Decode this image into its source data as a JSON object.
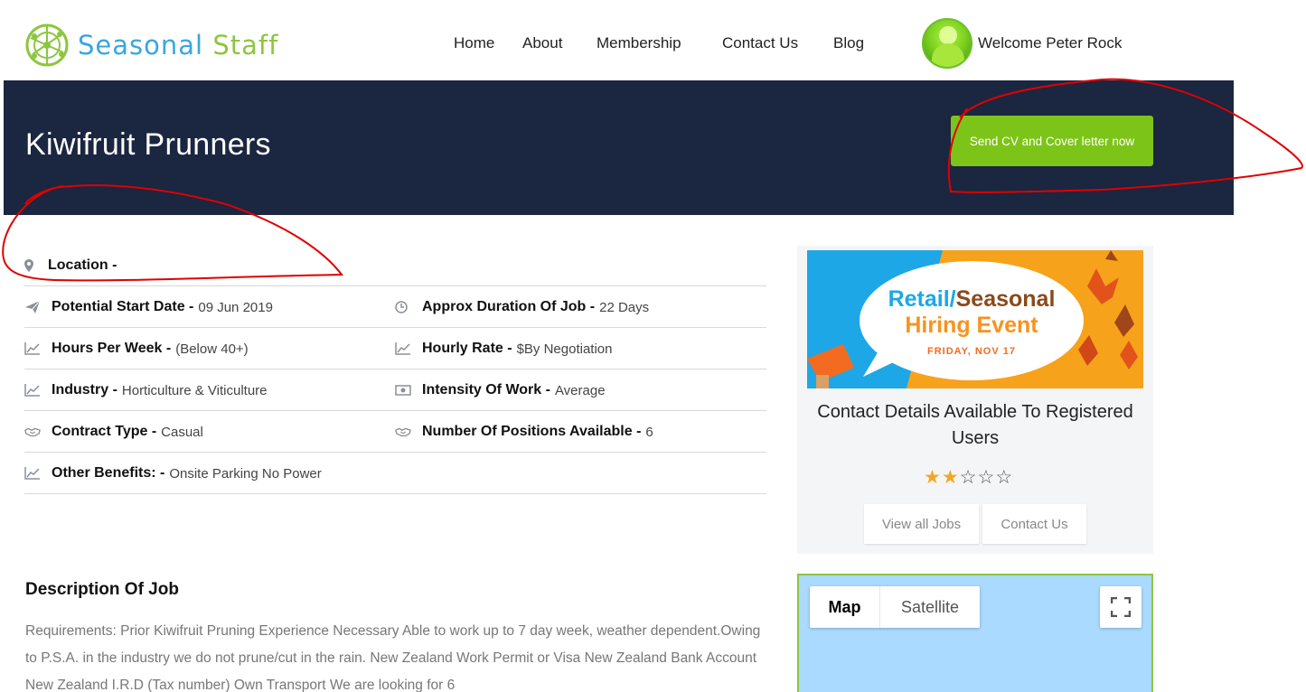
{
  "brand": {
    "name_part1": "Seasonal",
    "name_part2": "Staff"
  },
  "nav": {
    "home": "Home",
    "about": "About",
    "membership": "Membership",
    "contact": "Contact Us",
    "blog": "Blog"
  },
  "user": {
    "welcome": "Welcome Peter Rock"
  },
  "job": {
    "title": "Kiwifruit Prunners",
    "cta_label": "Send CV and Cover letter now",
    "location_label": "Location -",
    "rows": [
      {
        "label": "Potential Start Date -",
        "value": "09 Jun 2019",
        "icon": "paper-plane-icon",
        "label2": "Approx Duration Of Job -",
        "value2": "22 Days",
        "icon2": "clock-icon"
      },
      {
        "label": "Hours Per Week -",
        "value": "(Below 40+)",
        "icon": "line-chart-icon",
        "label2": "Hourly Rate -",
        "value2": "$By Negotiation",
        "icon2": "line-chart-icon"
      },
      {
        "label": "Industry -",
        "value": "Horticulture & Viticulture",
        "icon": "line-chart-icon",
        "label2": "Intensity Of Work -",
        "value2": "Average",
        "icon2": "money-icon"
      },
      {
        "label": "Contract Type -",
        "value": "Casual",
        "icon": "handshake-icon",
        "label2": "Number Of Positions Available -",
        "value2": "6",
        "icon2": "handshake-icon"
      },
      {
        "label": "Other Benefits: -",
        "value": "Onsite Parking No Power",
        "icon": "line-chart-icon"
      }
    ],
    "description_title": "Description Of Job",
    "description": "Requirements: Prior Kiwifruit Pruning Experience Necessary Able to work up to 7 day week, weather dependent.Owing to P.S.A. in the industry we do not prune/cut in the rain. New Zealand Work Permit or Visa New Zealand Bank Account New Zealand I.R.D (Tax number) Own Transport We are looking for 6"
  },
  "sidebar": {
    "promo": {
      "line1_a": "Retail/",
      "line1_b": "Seasonal",
      "line2": "Hiring Event",
      "date": "FRIDAY, NOV 17"
    },
    "contact_title": "Contact Details Available To Registered Users",
    "rating": {
      "value": 2,
      "max": 5
    },
    "view_jobs": "View all Jobs",
    "contact_us": "Contact Us"
  },
  "map": {
    "map_label": "Map",
    "satellite_label": "Satellite"
  },
  "colors": {
    "banner": "#1b2640",
    "accent_green": "#7dc418",
    "brand_blue": "#3aa6df",
    "brand_green": "#8cc63f",
    "annotation_red": "#e00000"
  }
}
